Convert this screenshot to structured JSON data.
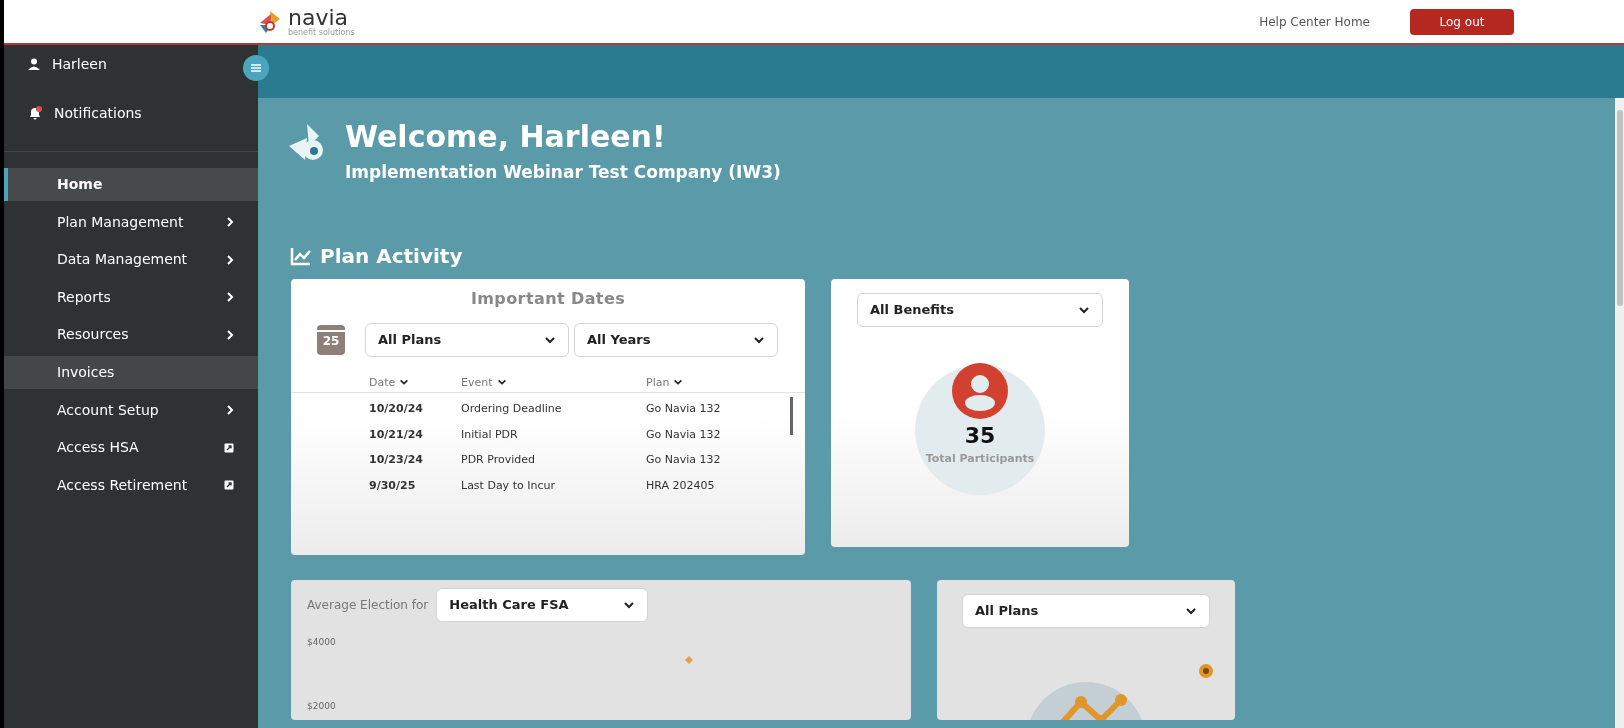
{
  "header": {
    "logo_text": "navia",
    "logo_tagline": "benefit solutions",
    "help_link": "Help Center Home",
    "logout_button": "Log out"
  },
  "sidebar": {
    "user": "Harleen",
    "notifications": {
      "label": "Notifications",
      "unread": true
    },
    "items": [
      {
        "label": "Home",
        "kind": "plain",
        "selected": true,
        "highlighted": false
      },
      {
        "label": "Plan Management",
        "kind": "submenu",
        "selected": false,
        "highlighted": false
      },
      {
        "label": "Data Management",
        "kind": "submenu",
        "selected": false,
        "highlighted": false
      },
      {
        "label": "Reports",
        "kind": "submenu",
        "selected": false,
        "highlighted": false
      },
      {
        "label": "Resources",
        "kind": "submenu",
        "selected": false,
        "highlighted": false
      },
      {
        "label": "Invoices",
        "kind": "plain",
        "selected": false,
        "highlighted": true
      },
      {
        "label": "Account Setup",
        "kind": "submenu",
        "selected": false,
        "highlighted": false
      },
      {
        "label": "Access HSA",
        "kind": "external",
        "selected": false,
        "highlighted": false
      },
      {
        "label": "Access Retirement",
        "kind": "external",
        "selected": false,
        "highlighted": false
      }
    ]
  },
  "welcome": {
    "title": "Welcome, Harleen!",
    "company": "Implementation Webinar Test Company (IW3)"
  },
  "section_title": "Plan Activity",
  "important_dates": {
    "title": "Important Dates",
    "calendar_day": "25",
    "plan_filter": "All Plans",
    "year_filter": "All Years",
    "columns": [
      "Date",
      "Event",
      "Plan"
    ],
    "rows": [
      {
        "date": "10/20/24",
        "event": "Ordering Deadline",
        "plan": "Go Navia 132"
      },
      {
        "date": "10/21/24",
        "event": "Initial PDR",
        "plan": "Go Navia 132"
      },
      {
        "date": "10/23/24",
        "event": "PDR Provided",
        "plan": "Go Navia 132"
      },
      {
        "date": "9/30/25",
        "event": "Last Day to Incur",
        "plan": "HRA 202405"
      }
    ]
  },
  "participants": {
    "filter": "All Benefits",
    "count": "35",
    "label": "Total Participants"
  },
  "average_election": {
    "label": "Average Election for",
    "filter": "Health Care FSA",
    "y_axis_labels": [
      "$4000",
      "$2000"
    ]
  },
  "plans_card": {
    "filter": "All Plans"
  }
}
